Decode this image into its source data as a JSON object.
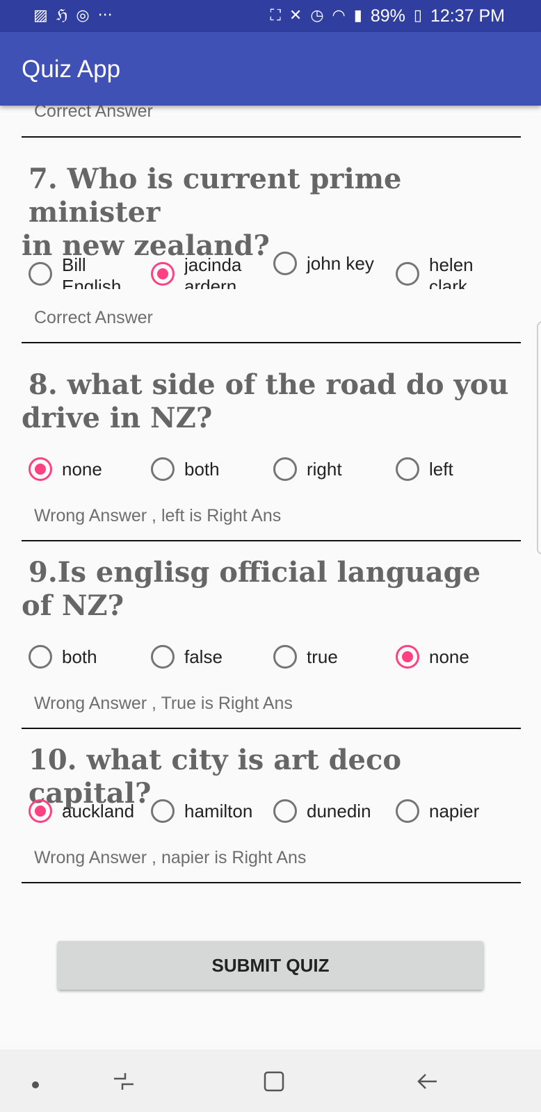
{
  "status_bar": {
    "left_icons": [
      "gallery-icon",
      "news-icon",
      "instagram-icon",
      "more-dots-icon"
    ],
    "right_icons": [
      "alarm-icon",
      "mute-icon",
      "clock-icon",
      "wifi-icon",
      "signal-icon"
    ],
    "battery": "89%",
    "time": "12:37 PM"
  },
  "app_bar": {
    "title": "Quiz App"
  },
  "top_partial": {
    "result": "Correct Answer"
  },
  "questions": [
    {
      "line1": "7. Who is current prime minister",
      "line2": "in new zealand?",
      "options": [
        {
          "label": "Bill English",
          "checked": false
        },
        {
          "label": "jacinda ardern",
          "checked": true
        },
        {
          "label": "john key",
          "checked": false
        },
        {
          "label": "helen clark",
          "checked": false
        }
      ],
      "result": "Correct Answer"
    },
    {
      "line1": "8. what side of the road do you",
      "line2": "drive in NZ?",
      "options": [
        {
          "label": "none",
          "checked": true
        },
        {
          "label": "both",
          "checked": false
        },
        {
          "label": "right",
          "checked": false
        },
        {
          "label": "left",
          "checked": false
        }
      ],
      "result": "Wrong Answer , left is Right Ans"
    },
    {
      "line1": "9.Is englisg official language",
      "line2": "of NZ?",
      "options": [
        {
          "label": "both",
          "checked": false
        },
        {
          "label": "false",
          "checked": false
        },
        {
          "label": "true",
          "checked": false
        },
        {
          "label": "none",
          "checked": true
        }
      ],
      "result": "Wrong Answer , True is Right Ans"
    },
    {
      "line1": "10. what city is art deco capital?",
      "line2": "",
      "options": [
        {
          "label": "auckland",
          "checked": true
        },
        {
          "label": "hamilton",
          "checked": false
        },
        {
          "label": "dunedin",
          "checked": false
        },
        {
          "label": "napier",
          "checked": false
        }
      ],
      "result": "Wrong Answer , napier is Right Ans"
    }
  ],
  "submit": {
    "label": "SUBMIT QUIZ"
  },
  "nav_bar": {
    "icons": [
      "nav-dot-icon",
      "recent-apps-icon",
      "home-icon",
      "back-icon"
    ]
  },
  "colors": {
    "primary": "#3f51b5",
    "primary_dark": "#303f9f",
    "accent": "#ff4081"
  }
}
